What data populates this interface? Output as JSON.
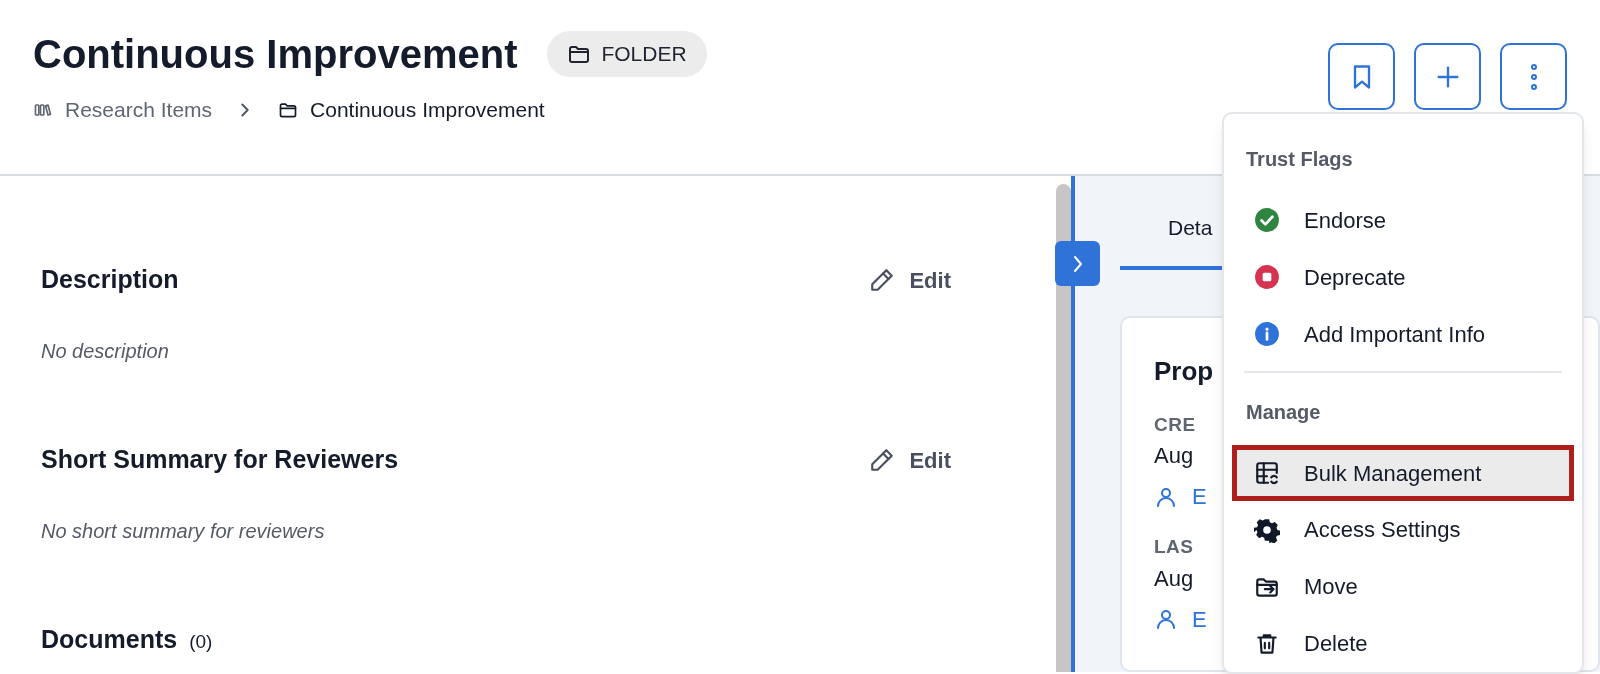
{
  "header": {
    "title": "Continuous Improvement",
    "badge": "FOLDER",
    "breadcrumb": [
      {
        "label": "Research Items",
        "kind": "library"
      },
      {
        "label": "Continuous Improvement",
        "kind": "folder"
      }
    ]
  },
  "toolbar": [
    {
      "kind": "bookmark"
    },
    {
      "kind": "add"
    },
    {
      "kind": "more"
    }
  ],
  "sections": [
    {
      "title": "Description",
      "action": "Edit",
      "body": "No description"
    },
    {
      "title": "Short Summary for Reviewers",
      "action": "Edit",
      "body": "No short summary for reviewers"
    },
    {
      "title": "Documents",
      "count": "(0)"
    }
  ],
  "detail_panel": {
    "tabs": [
      {
        "label": "Deta",
        "selected": true
      }
    ],
    "card_title": "Prop",
    "fields": [
      {
        "label": "CRE",
        "value": "Aug",
        "user": "E"
      },
      {
        "label": "LAS",
        "value": "Aug",
        "user": "E"
      }
    ]
  },
  "menu": {
    "groups": [
      {
        "title": "Trust Flags",
        "items": [
          {
            "label": "Endorse",
            "kind": "check",
            "selected": false
          },
          {
            "label": "Deprecate",
            "kind": "stop",
            "selected": false
          },
          {
            "label": "Add Important Info",
            "kind": "info",
            "selected": false
          }
        ]
      },
      {
        "title": "Manage",
        "items": [
          {
            "label": "Bulk Management",
            "kind": "table",
            "selected": true
          },
          {
            "label": "Access Settings",
            "kind": "gear",
            "selected": false
          },
          {
            "label": "Move",
            "kind": "move",
            "selected": false
          },
          {
            "label": "Delete",
            "kind": "trash",
            "selected": false
          }
        ]
      }
    ]
  }
}
